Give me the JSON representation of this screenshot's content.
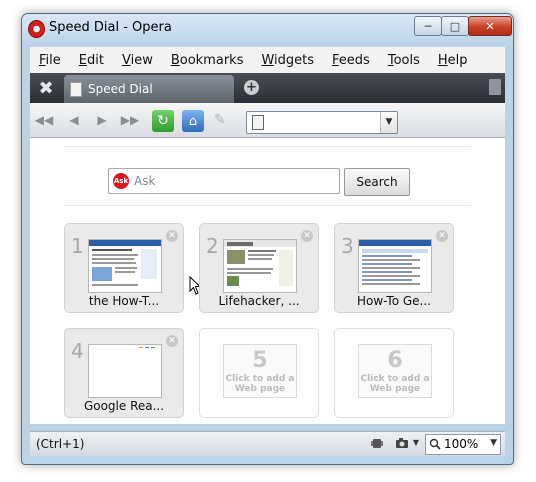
{
  "window": {
    "title": "Speed Dial - Opera"
  },
  "menu": [
    "File",
    "Edit",
    "View",
    "Bookmarks",
    "Widgets",
    "Feeds",
    "Tools",
    "Help"
  ],
  "tab": {
    "label": "Speed Dial",
    "icon": "page-icon"
  },
  "search": {
    "placeholder": "Ask",
    "button": "Search",
    "engine_icon": "ask-logo"
  },
  "tiles": [
    {
      "number": "1",
      "caption": "the How-T...",
      "thumbnail": "howtogeek-thumbnail"
    },
    {
      "number": "2",
      "caption": "Lifehacker, ...",
      "thumbnail": "lifehacker-thumbnail"
    },
    {
      "number": "3",
      "caption": "How-To Ge...",
      "thumbnail": "howtogeek-forum-thumbnail"
    },
    {
      "number": "4",
      "caption": "Google Rea...",
      "thumbnail": "google-reader-thumbnail"
    },
    {
      "number": "5",
      "add_text": "Click to add a Web page"
    },
    {
      "number": "6",
      "add_text": "Click to add a Web page"
    }
  ],
  "status": {
    "text": "(Ctrl+1)",
    "zoom": "100%"
  },
  "colors": {
    "reload_green": "#2f9e2d",
    "home_blue": "#2d6dbb",
    "close_red": "#c8402a"
  }
}
